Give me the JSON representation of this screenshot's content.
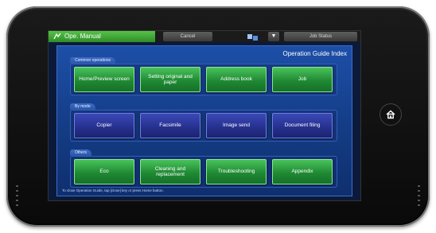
{
  "topbar": {
    "title": "Ope. Manual",
    "cancel_label": "Cancel",
    "dropdown_glyph": "▼",
    "job_status_label": "Job Status"
  },
  "page": {
    "heading": "Operation Guide Index",
    "footer_note": "To close Operation Guide, tap [close] key or press Home button."
  },
  "sections": [
    {
      "label": "Common operations",
      "buttons": [
        "Home/Preview screen",
        "Setting original and paper",
        "Address book",
        "Job"
      ]
    },
    {
      "label": "By mode",
      "buttons": [
        "Copier",
        "Facsimile",
        "Image send",
        "Document filing"
      ]
    },
    {
      "label": "Others",
      "buttons": [
        "Eco",
        "Cleaning and replacement",
        "Troubleshooting",
        "Appendix"
      ]
    }
  ],
  "colors": {
    "title_green": "#2f8d27",
    "panel_blue": "#143c85",
    "button_green": "#208a33",
    "button_blue": "#25308c"
  },
  "icons": {
    "title": "manual-icon",
    "status": "network-status-icon",
    "home_key": "home-icon"
  }
}
